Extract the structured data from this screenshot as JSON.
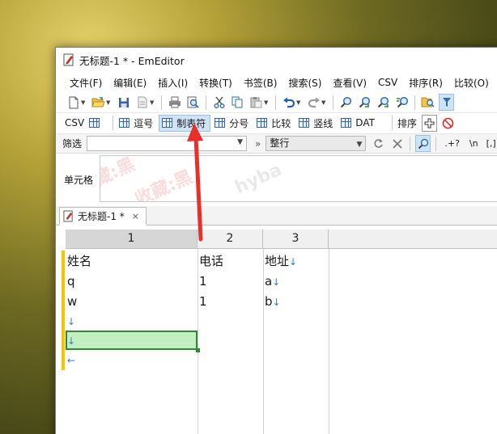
{
  "window": {
    "title": "无标题-1 * - EmEditor"
  },
  "menu": [
    "文件(F)",
    "编辑(E)",
    "插入(I)",
    "转换(T)",
    "书签(B)",
    "搜索(S)",
    "查看(V)",
    "CSV",
    "排序(R)",
    "比较(O)"
  ],
  "csv_toolbar": {
    "csv_label": "CSV",
    "buttons": [
      "逗号",
      "制表符",
      "分号",
      "比较",
      "竖线",
      "DAT"
    ],
    "active_button": "制表符",
    "sort_label": "排序"
  },
  "filter_bar": {
    "label": "筛选",
    "value": "",
    "more_symbol": "»",
    "mode": "整行",
    "regex_symbol": ".+?",
    "newline_symbol": "\\n",
    "bracket_symbol": "[,]"
  },
  "cell_panel": {
    "label": "单元格",
    "value": "",
    "watermark_1": "藏:黑",
    "watermark_2": "收藏:黑",
    "watermark_3": "hyba"
  },
  "document_tab": {
    "label": "无标题-1 *",
    "close_symbol": "×"
  },
  "table": {
    "column_headers": [
      "1",
      "2",
      "3"
    ],
    "selected_column": "1",
    "rows": [
      [
        "姓名",
        "电话",
        "地址"
      ],
      [
        "q",
        "1",
        "a"
      ],
      [
        "w",
        "1",
        "b"
      ],
      [
        "",
        "",
        ""
      ],
      [
        "",
        "",
        ""
      ],
      [
        "",
        "",
        ""
      ]
    ],
    "eol_symbol": "↓",
    "eof_symbol": "←"
  },
  "annotation": {
    "color": "#e8302a"
  }
}
